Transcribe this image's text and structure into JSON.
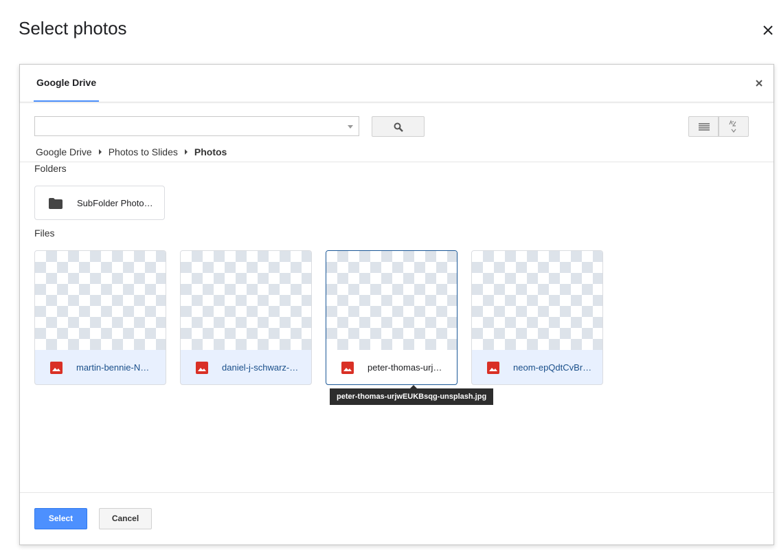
{
  "dialog": {
    "title": "Select photos"
  },
  "picker": {
    "tab_label": "Google Drive",
    "search": {
      "value": "",
      "placeholder": ""
    },
    "breadcrumb": [
      "Google Drive",
      "Photos to Slides",
      "Photos"
    ],
    "folders_label": "Folders",
    "folders": [
      {
        "name": "SubFolder Photo…"
      }
    ],
    "files_label": "Files",
    "files": [
      {
        "name": "martin-bennie-N…"
      },
      {
        "name": "daniel-j-schwarz-…"
      },
      {
        "name": "peter-thomas-urj…"
      },
      {
        "name": "neom-epQdtCvBr…"
      }
    ],
    "tooltip": "peter-thomas-urjwEUKBsqg-unsplash.jpg",
    "buttons": {
      "select": "Select",
      "cancel": "Cancel"
    }
  },
  "colors": {
    "accent": "#4d90fe",
    "image_icon": "#d93025",
    "tooltip_bg": "#2d2d2d"
  },
  "icons": {
    "outer_close": "close-icon",
    "picker_close": "close-icon",
    "search": "search-icon",
    "list_view": "list-view-icon",
    "sort": "sort-az-icon",
    "folder": "folder-icon",
    "file": "image-icon"
  }
}
